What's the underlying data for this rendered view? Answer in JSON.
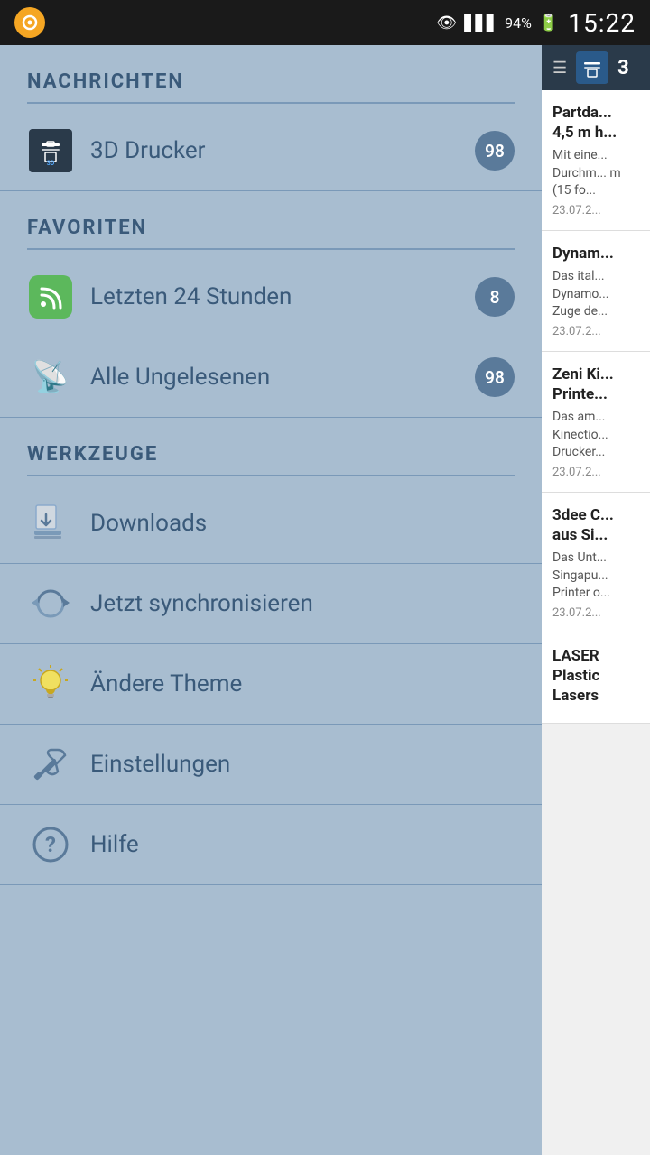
{
  "statusBar": {
    "time": "15:22",
    "battery": "94%",
    "appIconColor": "#f5a623"
  },
  "sidebar": {
    "sections": [
      {
        "id": "nachrichten",
        "label": "NACHRICHTEN",
        "items": [
          {
            "id": "3d-drucker",
            "label": "3D Drucker",
            "icon": "3d-printer-icon",
            "badge": "98"
          }
        ]
      },
      {
        "id": "favoriten",
        "label": "FAVORITEN",
        "items": [
          {
            "id": "letzten-24",
            "label": "Letzten 24 Stunden",
            "icon": "rss-icon",
            "badge": "8"
          },
          {
            "id": "alle-ungelesenen",
            "label": "Alle Ungelesenen",
            "icon": "wifi-icon",
            "badge": "98"
          }
        ]
      },
      {
        "id": "werkzeuge",
        "label": "WERKZEUGE",
        "items": [
          {
            "id": "downloads",
            "label": "Downloads",
            "icon": "download-icon",
            "badge": null
          },
          {
            "id": "jetzt-synchronisieren",
            "label": "Jetzt synchronisieren",
            "icon": "sync-icon",
            "badge": null
          },
          {
            "id": "andere-theme",
            "label": "Ändere Theme",
            "icon": "bulb-icon",
            "badge": null
          },
          {
            "id": "einstellungen",
            "label": "Einstellungen",
            "icon": "wrench-icon",
            "badge": null
          },
          {
            "id": "hilfe",
            "label": "Hilfe",
            "icon": "help-icon",
            "badge": null
          }
        ]
      }
    ]
  },
  "rightPanel": {
    "headerTitle": "3",
    "newsItems": [
      {
        "id": "news-1",
        "title": "Partda... 4,5 m h...",
        "excerpt": "Mit eine... Durchm... m (15 fo...",
        "date": "23.07.2..."
      },
      {
        "id": "news-2",
        "title": "Dynam...",
        "excerpt": "Das ital... Dynamo... Zuge de...",
        "date": "23.07.2..."
      },
      {
        "id": "news-3",
        "title": "Zeni Ki... Printe...",
        "excerpt": "Das am... Kinectio... Drucker...",
        "date": "23.07.2..."
      },
      {
        "id": "news-4",
        "title": "3dee C... aus Si...",
        "excerpt": "Das Unt... Singapu... Printer o...",
        "date": "23.07.2..."
      },
      {
        "id": "news-5",
        "title": "LASER Plastic Lasers",
        "excerpt": "",
        "date": ""
      }
    ]
  }
}
